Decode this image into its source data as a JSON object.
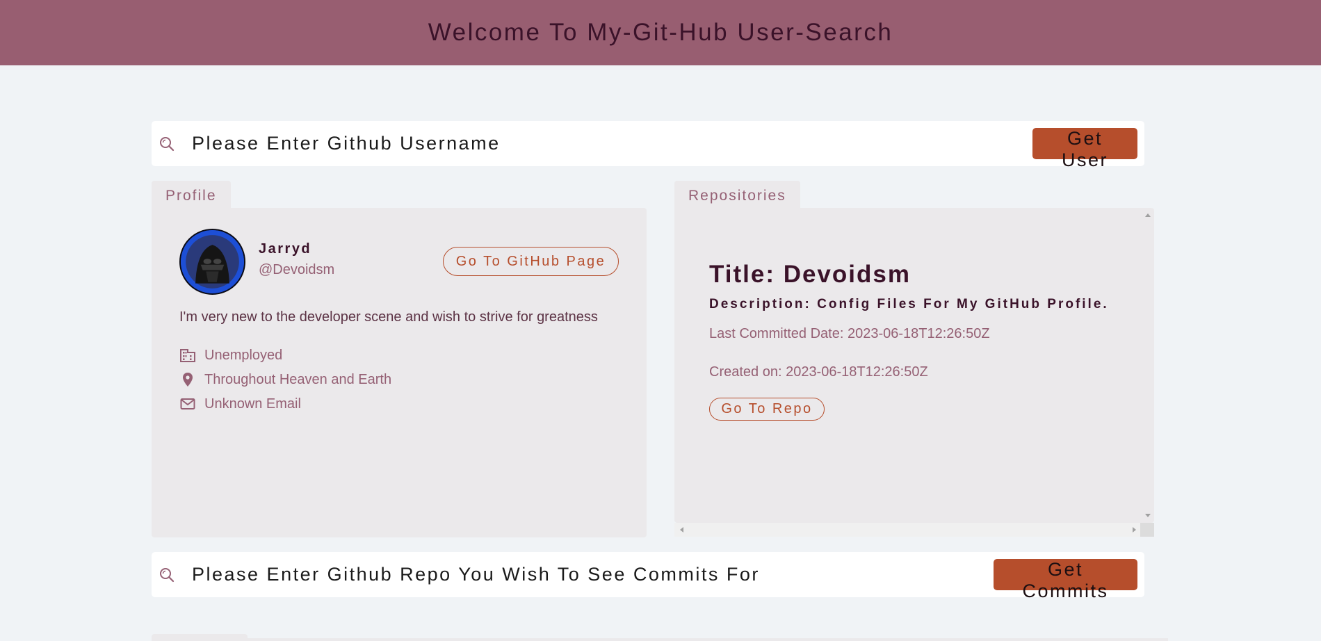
{
  "header": {
    "title": "Welcome To My-Git-Hub User-Search"
  },
  "user_search": {
    "placeholder": "Please Enter Github Username",
    "button_label": "Get User",
    "icon": "search-icon"
  },
  "profile": {
    "tab_label": "Profile",
    "name": "Jarryd",
    "login": "@Devoidsm",
    "github_button_label": "Go To GitHub Page",
    "bio": "I'm very new to the developer scene and wish to strive for greatness",
    "company": "Unemployed",
    "location": "Throughout Heaven and Earth",
    "email": "Unknown Email",
    "icons": [
      "building-icon",
      "location-pin-icon",
      "mail-icon"
    ]
  },
  "repositories": {
    "tab_label": "Repositories",
    "items": [
      {
        "title": "Title: Devoidsm",
        "description": "Description: Config Files For My GitHub Profile.",
        "last_committed": "Last Committed Date: 2023-06-18T12:26:50Z",
        "created_on": "Created on: 2023-06-18T12:26:50Z",
        "button_label": "Go To Repo"
      }
    ]
  },
  "repo_search": {
    "placeholder": "Please Enter Github Repo You Wish To See Commits For",
    "button_label": "Get Commits",
    "icon": "search-icon"
  },
  "colors": {
    "header_bg": "#985e71",
    "header_text": "#3a1229",
    "accent_button": "#b64e2c",
    "panel_bg": "#ebe9eb",
    "page_bg": "#f0f3f6",
    "muted_text": "#956074"
  }
}
